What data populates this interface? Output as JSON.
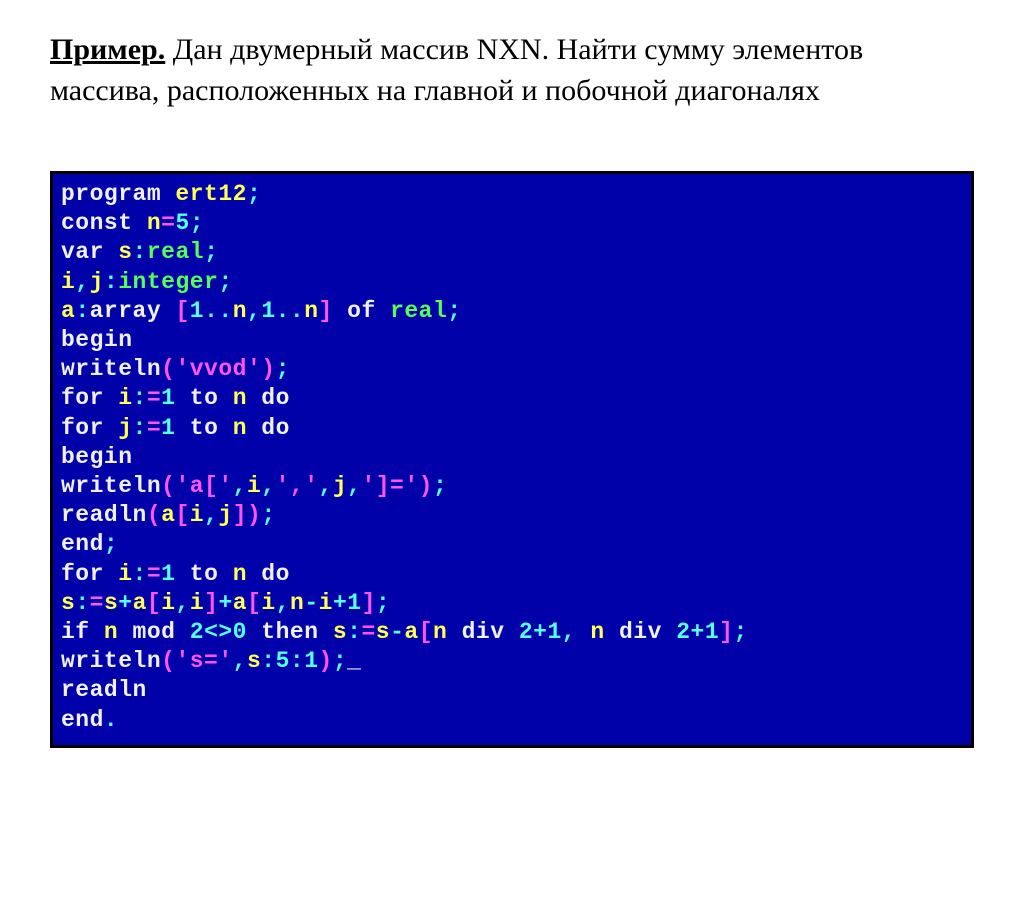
{
  "problem": {
    "label": "Пример.",
    "text": " Дан двумерный массив NXN. Найти сумму элементов массива, расположенных на главной и побочной диагоналях"
  },
  "code": {
    "l1": {
      "kw": "program ",
      "id": "ert12",
      "p": ";"
    },
    "l2": {
      "kw": "const ",
      "id": "n",
      "eq": "=",
      "num": "5",
      "p": ";"
    },
    "l3": {
      "kw": "var ",
      "id": "s",
      "col": ":",
      "grn": "real",
      "p": ";"
    },
    "l4": {
      "id1": "i",
      "c1": ",",
      "id2": "j",
      "col": ":",
      "grn": "integer",
      "p": ";"
    },
    "l5": {
      "id": "a",
      "col": ":",
      "kw": "array ",
      "br1": "[",
      "n1": "1",
      "d1": "..",
      "id2": "n",
      "c": ",",
      "n2": "1",
      "d2": "..",
      "id3": "n",
      "br2": "]",
      "kw2": " of ",
      "grn": "real",
      "p": ";"
    },
    "l6": {
      "kw": "begin"
    },
    "l7": {
      "kw": "writeln",
      "br1": "(",
      "str": "'vvod'",
      "br2": ")",
      "p": ";"
    },
    "l8": {
      "kw": "for ",
      "id": "i",
      "col": ":",
      "eq": "=",
      "n": "1",
      "kw2": " to ",
      "id2": "n",
      "kw3": " do"
    },
    "l9": {
      "kw": "for ",
      "id": "j",
      "col": ":",
      "eq": "=",
      "n": "1",
      "kw2": " to ",
      "id2": "n",
      "kw3": " do"
    },
    "l10": {
      "kw": "begin"
    },
    "l11": {
      "kw": "writeln",
      "br1": "(",
      "s1": "'a['",
      "c1": ",",
      "id1": "i",
      "c2": ",",
      "s2": "','",
      "c3": ",",
      "id2": "j",
      "c4": ",",
      "s3": "']='",
      "br2": ")",
      "p": ";"
    },
    "l12": {
      "kw": "readln",
      "br1": "(",
      "id1": "a",
      "br2": "[",
      "id2": "i",
      "c": ",",
      "id3": "j",
      "br3": "]",
      "br4": ")",
      "p": ";"
    },
    "l13": {
      "kw": "end",
      "p": ";"
    },
    "l14": {
      "kw": "for ",
      "id": "i",
      "col": ":",
      "eq": "=",
      "n": "1",
      "kw2": " to ",
      "id2": "n",
      "kw3": " do"
    },
    "l15": {
      "id1": "s",
      "col1": ":",
      "eq": "=",
      "id2": "s",
      "op1": "+",
      "id3": "a",
      "br1": "[",
      "id4": "i",
      "c1": ",",
      "id5": "i",
      "br2": "]",
      "op2": "+",
      "id6": "a",
      "br3": "[",
      "id7": "i",
      "c2": ",",
      "id8": "n",
      "op3": "-",
      "id9": "i",
      "op4": "+",
      "n1": "1",
      "br4": "]",
      "p": ";"
    },
    "l16": {
      "kw": "if ",
      "id1": "n",
      "kw2": " mod ",
      "n1": "2",
      "op1": "<>",
      "n2": "0",
      "kw3": " then ",
      "id2": "s",
      "col": ":",
      "eq": "=",
      "id3": "s",
      "op2": "-",
      "id4": "a",
      "br1": "[",
      "id5": "n",
      "kw4": " div ",
      "n3": "2",
      "op3": "+",
      "n4": "1",
      "c": ",",
      "sp": " ",
      "id6": "n",
      "kw5": " div ",
      "n5": "2",
      "op4": "+",
      "n6": "1",
      "br2": "]",
      "p": ";"
    },
    "l17": {
      "kw": "writeln",
      "br1": "(",
      "s1": "'s='",
      "c1": ",",
      "id1": "s",
      "col1": ":",
      "n1": "5",
      "col2": ":",
      "n2": "1",
      "br2": ")",
      "p": ";",
      "cur": "_"
    },
    "l18": {
      "kw": "readln"
    },
    "l19": {
      "kw": "end",
      "p": "."
    }
  }
}
